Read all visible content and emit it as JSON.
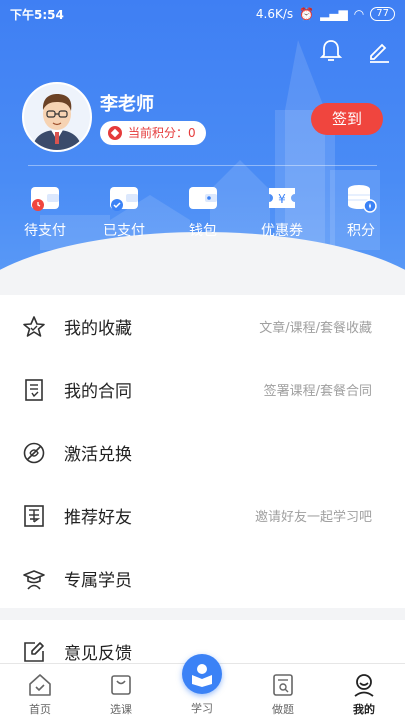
{
  "status_bar": {
    "time": "下午5:54",
    "speed": "4.6K/s",
    "battery": "77"
  },
  "profile": {
    "name": "李老师",
    "points_label": "当前积分：0",
    "signin_label": "签到"
  },
  "quick_actions": [
    {
      "label": "待支付",
      "icon": "pending-payment-icon"
    },
    {
      "label": "已支付",
      "icon": "paid-wallet-icon"
    },
    {
      "label": "钱包",
      "icon": "wallet-icon"
    },
    {
      "label": "优惠券",
      "icon": "coupon-icon"
    },
    {
      "label": "积分",
      "icon": "points-icon"
    }
  ],
  "menu": [
    {
      "label": "我的收藏",
      "hint": "文章/课程/套餐收藏",
      "icon": "star-icon"
    },
    {
      "label": "我的合同",
      "hint": "签署课程/套餐合同",
      "icon": "contract-icon"
    },
    {
      "label": "激活兑换",
      "hint": "",
      "icon": "activate-icon"
    },
    {
      "label": "推荐好友",
      "hint": "邀请好友一起学习吧",
      "icon": "recommend-icon"
    },
    {
      "label": "专属学员",
      "hint": "",
      "icon": "graduate-icon"
    }
  ],
  "menu2": [
    {
      "label": "意见反馈",
      "icon": "feedback-icon"
    }
  ],
  "nav": [
    {
      "label": "首页",
      "icon": "home-icon"
    },
    {
      "label": "选课",
      "icon": "course-bag-icon"
    },
    {
      "label": "学习",
      "icon": "study-icon"
    },
    {
      "label": "做题",
      "icon": "exercise-icon"
    },
    {
      "label": "我的",
      "icon": "profile-icon"
    }
  ],
  "colors": {
    "header": "#4a8cf5",
    "accent_red": "#f0453e",
    "study_blue": "#3b82f6"
  }
}
